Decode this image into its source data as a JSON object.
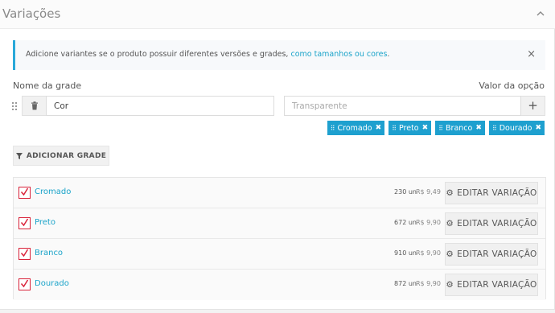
{
  "panel": {
    "title": "Variações"
  },
  "alert": {
    "text": "Adicione variantes se o produto possuir diferentes versões e grades,",
    "link": "como tamanhos ou cores",
    "suffix": ".",
    "close": "×"
  },
  "grade": {
    "name_label": "Nome da grade",
    "value_label": "Valor da opção",
    "name_value": "Cor",
    "value_placeholder": "Transparente",
    "plus_label": "+",
    "tags": [
      "Cromado",
      "Preto",
      "Branco",
      "Dourado"
    ]
  },
  "add_grade_label": "ADICIONAR GRADE",
  "variations": [
    {
      "name": "Cromado",
      "qty": "230 un",
      "price": "R$ 9,49",
      "checked": true
    },
    {
      "name": "Preto",
      "qty": "672 un",
      "price": "R$ 9,90",
      "checked": true
    },
    {
      "name": "Branco",
      "qty": "910 un",
      "price": "R$ 9,90",
      "checked": true
    },
    {
      "name": "Dourado",
      "qty": "872 un",
      "price": "R$ 9,90",
      "checked": true
    }
  ],
  "edit_label": "EDITAR VARIAÇÃO",
  "colors": {
    "accent": "#1ea0cf",
    "checkbox": "#d9233a",
    "link": "#1aa3c9"
  },
  "icons": [
    "chevron-up-icon",
    "close-icon",
    "drag-handle-icon",
    "trash-icon",
    "plus-icon",
    "filter-icon",
    "gear-icon",
    "checkbox-checked-icon"
  ]
}
